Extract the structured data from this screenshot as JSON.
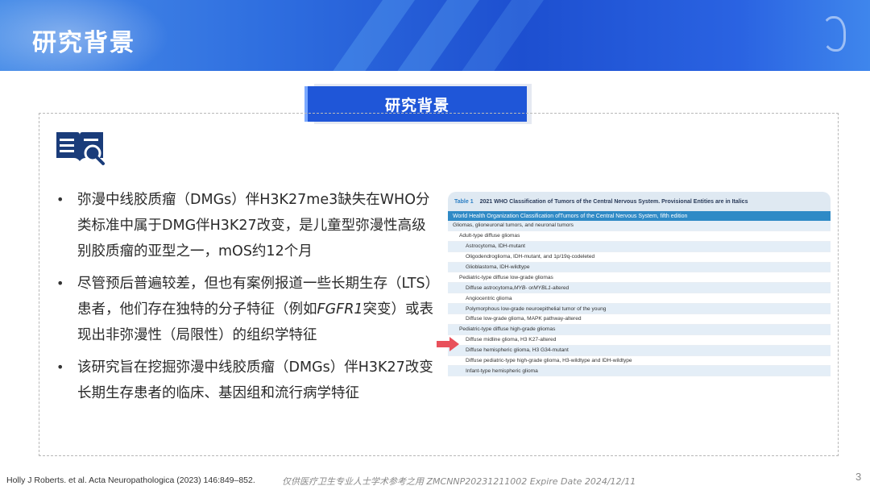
{
  "header": {
    "title": "研究背景"
  },
  "section": {
    "label": "研究背景"
  },
  "bullets": [
    {
      "text": "弥漫中线胶质瘤（DMGs）伴H3K27me3缺失在WHO分类标准中属于DMG伴H3K27改变，是儿童型弥漫性高级别胶质瘤的亚型之一，mOS约12个月"
    },
    {
      "text_before": "尽管预后普遍较差，但也有案例报道一些长期生存（LTS）患者，他们存在独特的分子特征（例如",
      "text_italic": "FGFR1",
      "text_after": "突变）或表现出非弥漫性（局限性）的组织学特征"
    },
    {
      "text": "该研究旨在挖掘弥漫中线胶质瘤（DMGs）伴H3K27改变长期生存患者的临床、基因组和流行病学特征"
    }
  ],
  "who_table": {
    "table_label": "Table 1",
    "caption": "2021 WHO Classification of Tumors of the Central Nervous System. Provisional Entities are in Italics",
    "subheader": "World Health Organization Classification ofTumors of the Central Nervous System, fifth edition",
    "rows": [
      {
        "level": 0,
        "text": "Gliomas, glioneuronal tumors, and neuronal tumors"
      },
      {
        "level": 1,
        "text": "Adult-type diffuse gliomas"
      },
      {
        "level": 2,
        "text": "Astrocytoma, IDH-mutant"
      },
      {
        "level": 2,
        "text": "Oligodendroglioma, IDH-mutant, and 1p/19q-codeleted"
      },
      {
        "level": 2,
        "text": "Glioblastoma, IDH-wildtype"
      },
      {
        "level": 1,
        "text": "Pediatric-type diffuse low-grade gliomas"
      },
      {
        "level": 2,
        "text_parts": [
          "Diffuse astrocytoma, ",
          "MYB",
          "- or ",
          "MYBL1",
          "-altered"
        ]
      },
      {
        "level": 2,
        "text": "Angiocentric glioma"
      },
      {
        "level": 2,
        "text": "Polymorphous low-grade neuroepithelial tumor of the young"
      },
      {
        "level": 2,
        "text": "Diffuse low-grade glioma, MAPK pathway-altered"
      },
      {
        "level": 1,
        "text": "Pediatric-type diffuse high-grade gliomas"
      },
      {
        "level": 2,
        "text": "Diffuse midline glioma, H3 K27-altered"
      },
      {
        "level": 2,
        "text": "Diffuse hemispheric glioma, H3 G34-mutant"
      },
      {
        "level": 2,
        "text": "Diffuse pediatric-type high-grade glioma, H3-wildtype and IDH-wildtype"
      },
      {
        "level": 2,
        "text": "Infant-type hemispheric glioma"
      }
    ]
  },
  "footer": {
    "citation": "Holly J Roberts. et al. Acta Neuropathologica (2023) 146:849–852.",
    "note": "仅供医疗卫生专业人士学术参考之用 ZMCNNP20231211002 Expire Date 2024/12/11",
    "page_number": "3"
  },
  "colors": {
    "brand_blue": "#1f56d8",
    "arrow_red": "#e8505b",
    "table_blue": "#2f8ac6"
  }
}
